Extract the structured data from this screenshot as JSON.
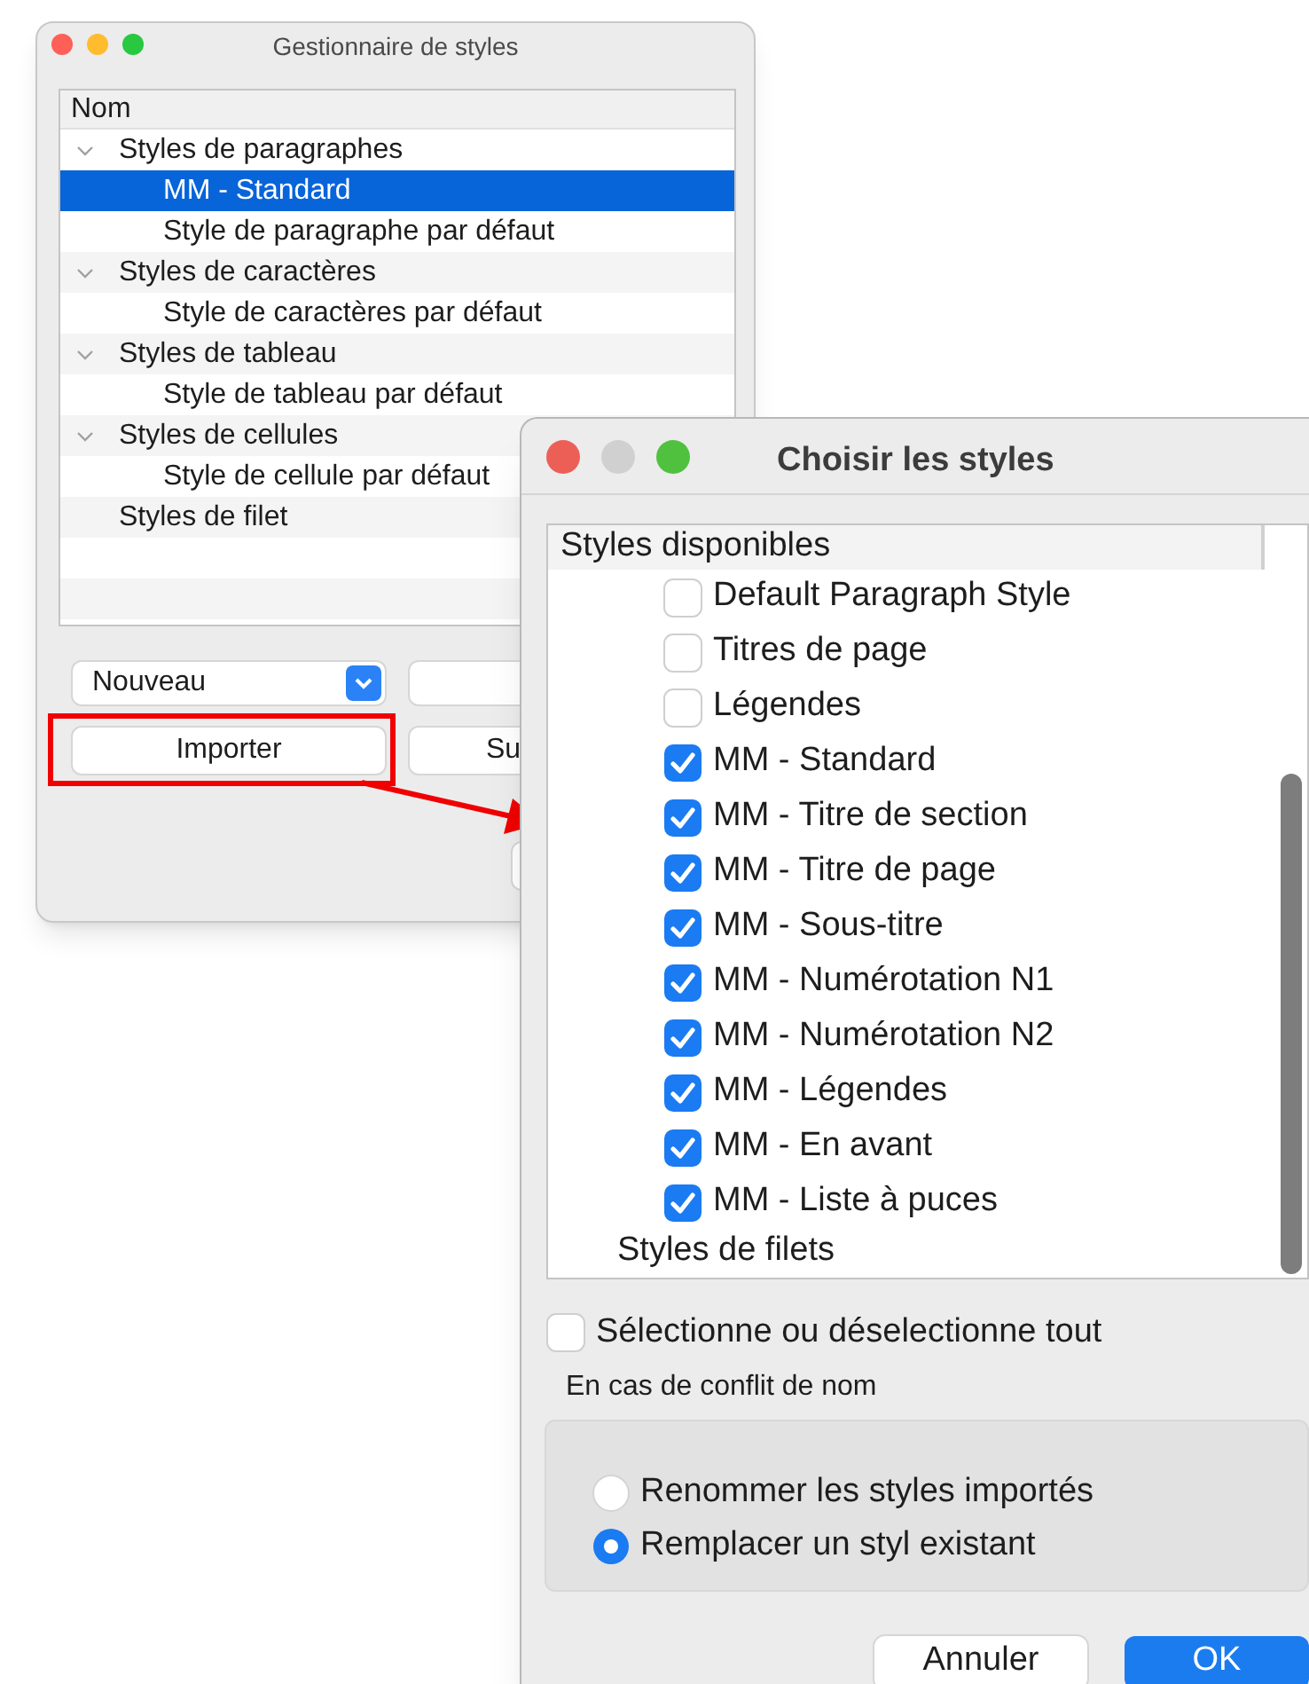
{
  "back_window": {
    "title": "Gestionnaire de styles",
    "tree": {
      "column": "Nom",
      "groups": [
        {
          "label": "Styles de paragraphes",
          "expanded": true,
          "children": [
            {
              "label": "MM - Standard",
              "selected": true
            },
            {
              "label": "Style de paragraphe par défaut",
              "selected": false
            }
          ]
        },
        {
          "label": "Styles de caractères",
          "expanded": true,
          "children": [
            {
              "label": "Style de caractères par défaut",
              "selected": false
            }
          ]
        },
        {
          "label": "Styles de tableau",
          "expanded": true,
          "children": [
            {
              "label": "Style de tableau par défaut",
              "selected": false
            }
          ]
        },
        {
          "label": "Styles de cellules",
          "expanded": true,
          "children": [
            {
              "label": "Style de cellule par défaut",
              "selected": false
            }
          ]
        },
        {
          "label": "Styles de filet"
        }
      ]
    },
    "dropdown": {
      "value": "Nouveau"
    },
    "buttons": [
      {
        "label": "Importer"
      },
      {
        "label": "Su"
      }
    ]
  },
  "front_window": {
    "title": "Choisir les styles",
    "list": {
      "header": "Styles disponibles",
      "items": [
        {
          "kind": "check",
          "label": "Default Paragraph Style",
          "checked": false
        },
        {
          "kind": "check",
          "label": "Titres de page",
          "checked": false
        },
        {
          "kind": "check",
          "label": "Légendes",
          "checked": false
        },
        {
          "kind": "check",
          "label": "MM - Standard",
          "checked": true
        },
        {
          "kind": "check",
          "label": "MM - Titre de section",
          "checked": true
        },
        {
          "kind": "check",
          "label": "MM - Titre de page",
          "checked": true
        },
        {
          "kind": "check",
          "label": "MM - Sous-titre",
          "checked": true
        },
        {
          "kind": "check",
          "label": "MM - Numérotation N1",
          "checked": true
        },
        {
          "kind": "check",
          "label": "MM - Numérotation N2",
          "checked": true
        },
        {
          "kind": "check",
          "label": "MM - Légendes",
          "checked": true
        },
        {
          "kind": "check",
          "label": "MM - En avant",
          "checked": true
        },
        {
          "kind": "check",
          "label": "MM - Liste à puces",
          "checked": true
        },
        {
          "kind": "heading",
          "label": "Styles de filets"
        }
      ]
    },
    "select_all": {
      "label": "Sélectionne ou déselectionne tout",
      "checked": false
    },
    "conflict": {
      "label": "En cas de conflit de nom",
      "options": [
        {
          "label": "Renommer les styles importés",
          "selected": false
        },
        {
          "label": "Remplacer un styl existant",
          "selected": true
        }
      ]
    },
    "buttons": [
      {
        "label": "Annuler",
        "kind": "secondary"
      },
      {
        "label": "OK",
        "kind": "primary"
      }
    ]
  }
}
